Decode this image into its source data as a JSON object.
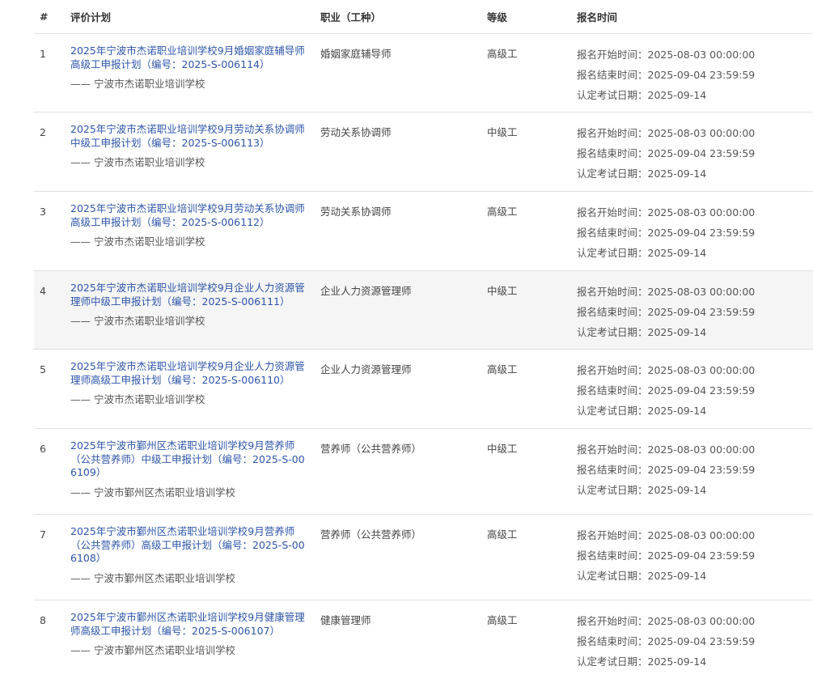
{
  "headers": {
    "num": "#",
    "plan": "评价计划",
    "job": "职业（工种）",
    "level": "等级",
    "time": "报名时间"
  },
  "rows": [
    {
      "num": "1",
      "plan": "2025年宁波市杰诺职业培训学校9月婚姻家庭辅导师高级工申报计划（编号：2025-S-006114）",
      "org": "—— 宁波市杰诺职业培训学校",
      "job": "婚姻家庭辅导师",
      "level": "高级工",
      "start": "报名开始时间：2025-08-03 00:00:00",
      "end": "报名结束时间：2025-09-04 23:59:59",
      "exam": "认定考试日期：2025-09-14"
    },
    {
      "num": "2",
      "plan": "2025年宁波市杰诺职业培训学校9月劳动关系协调师中级工申报计划（编号：2025-S-006113）",
      "org": "—— 宁波市杰诺职业培训学校",
      "job": "劳动关系协调师",
      "level": "中级工",
      "start": "报名开始时间：2025-08-03 00:00:00",
      "end": "报名结束时间：2025-09-04 23:59:59",
      "exam": "认定考试日期：2025-09-14"
    },
    {
      "num": "3",
      "plan": "2025年宁波市杰诺职业培训学校9月劳动关系协调师高级工申报计划（编号：2025-S-006112）",
      "org": "—— 宁波市杰诺职业培训学校",
      "job": "劳动关系协调师",
      "level": "高级工",
      "start": "报名开始时间：2025-08-03 00:00:00",
      "end": "报名结束时间：2025-09-04 23:59:59",
      "exam": "认定考试日期：2025-09-14"
    },
    {
      "num": "4",
      "plan": "2025年宁波市杰诺职业培训学校9月企业人力资源管理师中级工申报计划（编号：2025-S-006111）",
      "org": "—— 宁波市杰诺职业培训学校",
      "job": "企业人力资源管理师",
      "level": "中级工",
      "start": "报名开始时间：2025-08-03 00:00:00",
      "end": "报名结束时间：2025-09-04 23:59:59",
      "exam": "认定考试日期：2025-09-14"
    },
    {
      "num": "5",
      "plan": "2025年宁波市杰诺职业培训学校9月企业人力资源管理师高级工申报计划（编号：2025-S-006110）",
      "org": "—— 宁波市杰诺职业培训学校",
      "job": "企业人力资源管理师",
      "level": "高级工",
      "start": "报名开始时间：2025-08-03 00:00:00",
      "end": "报名结束时间：2025-09-04 23:59:59",
      "exam": "认定考试日期：2025-09-14"
    },
    {
      "num": "6",
      "plan": "2025年宁波市鄞州区杰诺职业培训学校9月营养师（公共营养师）中级工申报计划（编号：2025-S-006109）",
      "org": "—— 宁波市鄞州区杰诺职业培训学校",
      "job": "营养师（公共营养师）",
      "level": "中级工",
      "start": "报名开始时间：2025-08-03 00:00:00",
      "end": "报名结束时间：2025-09-04 23:59:59",
      "exam": "认定考试日期：2025-09-14"
    },
    {
      "num": "7",
      "plan": "2025年宁波市鄞州区杰诺职业培训学校9月营养师（公共营养师）高级工申报计划（编号：2025-S-006108）",
      "org": "—— 宁波市鄞州区杰诺职业培训学校",
      "job": "营养师（公共营养师）",
      "level": "高级工",
      "start": "报名开始时间：2025-08-03 00:00:00",
      "end": "报名结束时间：2025-09-04 23:59:59",
      "exam": "认定考试日期：2025-09-14"
    },
    {
      "num": "8",
      "plan": "2025年宁波市鄞州区杰诺职业培训学校9月健康管理师高级工申报计划（编号：2025-S-006107）",
      "org": "—— 宁波市鄞州区杰诺职业培训学校",
      "job": "健康管理师",
      "level": "高级工",
      "start": "报名开始时间：2025-08-03 00:00:00",
      "end": "报名结束时间：2025-09-04 23:59:59",
      "exam": "认定考试日期：2025-09-14"
    }
  ],
  "colors": {
    "link": "#2d55a8",
    "row_highlight": "#f5f5f5",
    "divider": "#e0e0e0"
  }
}
